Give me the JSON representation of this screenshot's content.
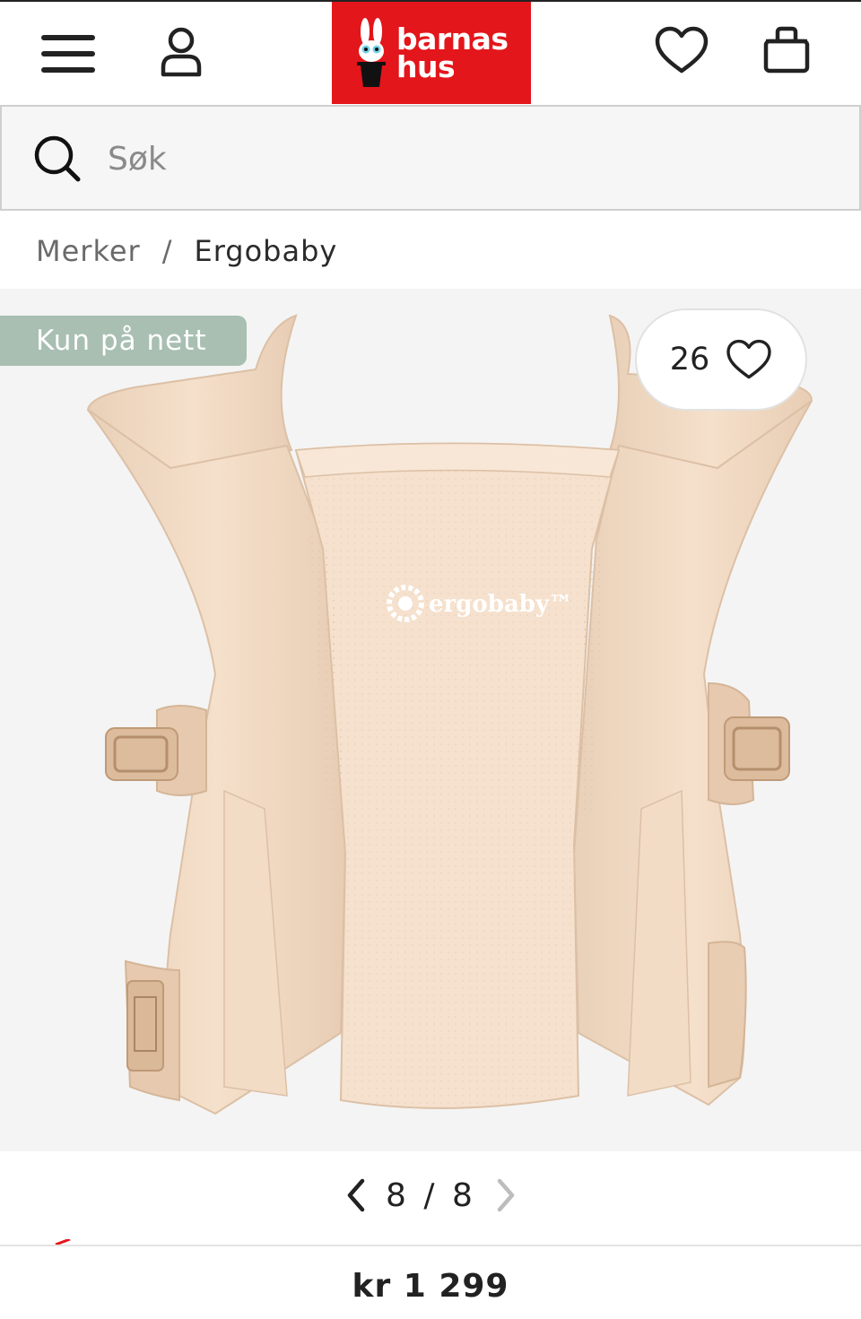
{
  "header": {
    "logo_line1": "barnas",
    "logo_line2": "hus",
    "brand_color": "#e3161b",
    "icons": [
      "menu-icon",
      "account-icon",
      "heart-icon",
      "shopping-bag-icon"
    ]
  },
  "search": {
    "placeholder": "Søk",
    "value": ""
  },
  "breadcrumb": {
    "items": [
      "Merker",
      "Ergobaby"
    ],
    "separator": "/"
  },
  "gallery": {
    "badge": "Kun på nett",
    "badge_color": "#a8bfb2",
    "favorite_count": "26",
    "product_logo_text": "ergobaby™",
    "current_image": "8",
    "pager_separator": "/",
    "total_images": "8"
  },
  "product": {
    "price": "kr 1 299"
  }
}
